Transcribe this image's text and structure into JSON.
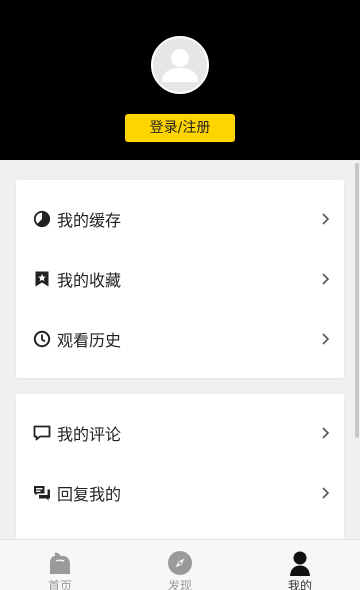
{
  "header": {
    "login_label": "登录/注册"
  },
  "menu_group_1": {
    "items": [
      {
        "label": "我的缓存",
        "icon": "pie-chart-icon"
      },
      {
        "label": "我的收藏",
        "icon": "bookmark-star-icon"
      },
      {
        "label": "观看历史",
        "icon": "clock-icon"
      }
    ]
  },
  "menu_group_2": {
    "items": [
      {
        "label": "我的评论",
        "icon": "comment-icon"
      },
      {
        "label": "回复我的",
        "icon": "reply-icon"
      }
    ]
  },
  "tabbar": {
    "tabs": [
      {
        "label": "首页",
        "icon": "home-icon"
      },
      {
        "label": "发现",
        "icon": "compass-icon"
      },
      {
        "label": "我的",
        "icon": "profile-icon"
      }
    ],
    "active_tab": "我的"
  },
  "colors": {
    "header_bg": "#000000",
    "login_button": "#ffd500",
    "page_bg": "#f0f0f0"
  }
}
